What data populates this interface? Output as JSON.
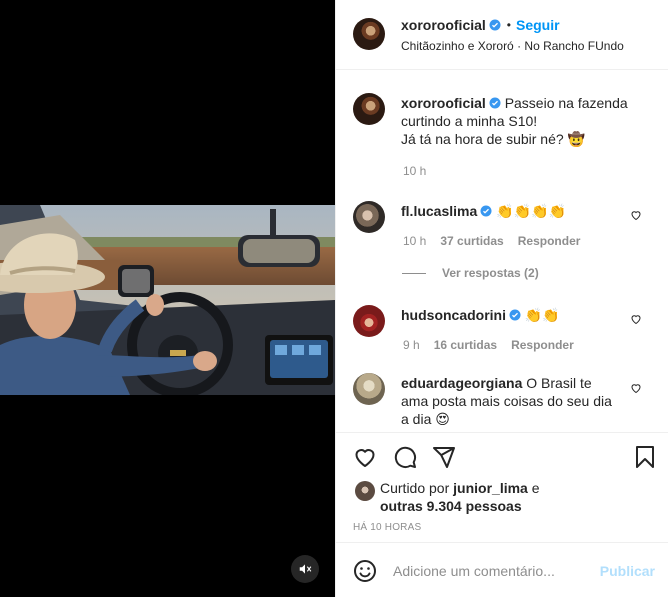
{
  "post": {
    "author": "xororooficial",
    "follow_label": "Seguir",
    "dot": "•",
    "location": "Chitãozinho e Xororó · No Rancho FUndo",
    "caption_line1": "Passeio na fazenda",
    "caption_line2": "curtindo a minha S10!",
    "caption_line3": "Já tá na hora de subir né?",
    "caption_emoji": "🤠",
    "caption_time": "10 h"
  },
  "comments": [
    {
      "user": "fl.lucaslima",
      "text": "👏👏👏👏",
      "time": "10 h",
      "likes": "37 curtidas",
      "reply": "Responder",
      "view_replies": "Ver respostas (2)"
    },
    {
      "user": "hudsoncadorini",
      "text": "👏👏",
      "time": "9 h",
      "likes": "16 curtidas",
      "reply": "Responder"
    },
    {
      "user": "eduardageorgiana",
      "text_line1": "O Brasil te",
      "text_line2": "ama posta mais coisas do seu dia",
      "text_line3": "a dia",
      "emoji": "😍"
    }
  ],
  "likes": {
    "prefix": "Curtido por",
    "user": "junior_lima",
    "conj": "e",
    "others": "outras 9.304 pessoas"
  },
  "timestamp": "HÁ 10 HORAS",
  "add_comment": {
    "placeholder": "Adicione um comentário...",
    "publish": "Publicar"
  },
  "colors": {
    "accent": "#0095f6",
    "verified": "#3897f0",
    "publish_disabled": "#b2dffc",
    "muted_text": "#8e8e8e"
  },
  "icons": [
    "mute-icon",
    "heart-icon",
    "comment-icon",
    "share-icon",
    "bookmark-icon",
    "emoji-icon",
    "verified-badge-icon"
  ]
}
